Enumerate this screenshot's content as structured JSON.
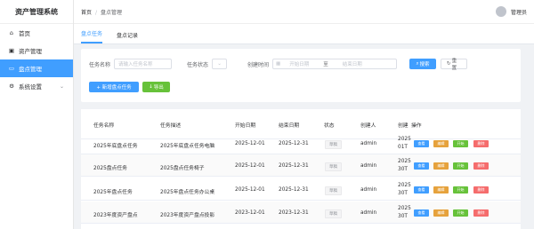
{
  "sidebar": {
    "title": "资产管理系统",
    "items": [
      {
        "label": "首页",
        "icon": "home-icon"
      },
      {
        "label": "资产管理",
        "icon": "bag-icon"
      },
      {
        "label": "盘点管理",
        "icon": "monitor-icon",
        "active": true
      },
      {
        "label": "系统设置",
        "icon": "gear-icon"
      }
    ]
  },
  "header": {
    "crumb_home": "首页",
    "crumb_sep": "/",
    "crumb_current": "盘点管理",
    "user_name": "管理员"
  },
  "tabs": [
    "盘点任务",
    "盘点记录"
  ],
  "search": {
    "task_name_label": "任务名称",
    "task_name_placeholder": "请输入任务名称",
    "status_label": "任务状态",
    "created_label": "创建时间",
    "start_placeholder": "开始日期",
    "range_sep": "至",
    "end_placeholder": "结束日期",
    "search_btn": "搜索",
    "reset_btn": "重置",
    "add_btn": "+ 新增盘点任务",
    "export_btn": "导出"
  },
  "table": {
    "columns": [
      "任务名称",
      "任务描述",
      "开始日期",
      "结束日期",
      "状态",
      "创建人",
      "创建",
      "操作"
    ],
    "rows": [
      {
        "name": "2025年底盘点任务",
        "desc": "2025年底盘点任务电脑",
        "start": "2025-12-01",
        "end": "2025-12-31",
        "status": "草稿",
        "creator": "admin",
        "created1": "2025",
        "created2": "01T"
      },
      {
        "name": "2025盘点任务",
        "desc": "2025盘点任务椅子",
        "start": "2025-12-01",
        "end": "2025-12-31",
        "status": "草稿",
        "creator": "admin",
        "created1": "2025",
        "created2": "30T"
      },
      {
        "name": "2025年盘点任务",
        "desc": "2025年盘点任务办公桌",
        "start": "2025-12-01",
        "end": "2025-12-31",
        "status": "草稿",
        "creator": "admin",
        "created1": "2025",
        "created2": "30T"
      },
      {
        "name": "2023年度资产盘点",
        "desc": "2023年度资产盘点投影",
        "start": "2023-12-01",
        "end": "2023-12-31",
        "status": "草稿",
        "creator": "admin",
        "created1": "2025",
        "created2": "30T"
      }
    ],
    "ops": [
      "查看",
      "编辑",
      "开始",
      "删除"
    ]
  }
}
